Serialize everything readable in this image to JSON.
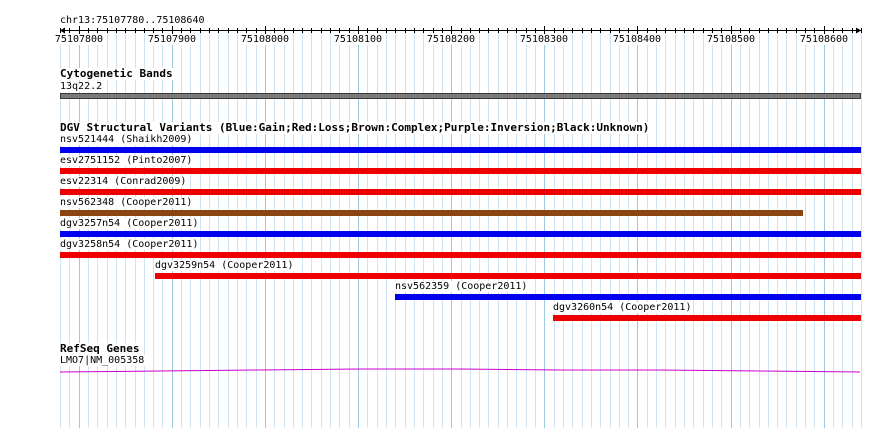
{
  "ruler": {
    "location": "chr13:75107780..75108640",
    "ticks": [
      "75107800",
      "75107900",
      "75108000",
      "75108100",
      "75108200",
      "75108300",
      "75108400",
      "75108500",
      "75108600"
    ]
  },
  "cytobands": {
    "title": "Cytogenetic Bands",
    "band_label": "13q22.2",
    "band_color": "#7a7a7a"
  },
  "dgv": {
    "title": "DGV Structural Variants (Blue:Gain;Red:Loss;Brown:Complex;Purple:Inversion;Black:Unknown)",
    "features": [
      {
        "label": "nsv521444 (Shaikh2009)",
        "start": 75107780,
        "end": 75108640,
        "color": "#0000ee"
      },
      {
        "label": "esv2751152 (Pinto2007)",
        "start": 75107780,
        "end": 75108640,
        "color": "#ee0000"
      },
      {
        "label": "esv22314 (Conrad2009)",
        "start": 75107780,
        "end": 75108640,
        "color": "#ee0000"
      },
      {
        "label": "nsv562348 (Cooper2011)",
        "start": 75107780,
        "end": 75108578,
        "color": "#8b4513"
      },
      {
        "label": "dgv3257n54 (Cooper2011)",
        "start": 75107780,
        "end": 75108640,
        "color": "#0000ee"
      },
      {
        "label": "dgv3258n54 (Cooper2011)",
        "start": 75107780,
        "end": 75108640,
        "color": "#ee0000"
      },
      {
        "label": "dgv3259n54 (Cooper2011)",
        "start": 75107882,
        "end": 75108640,
        "color": "#ee0000"
      },
      {
        "label": "nsv562359 (Cooper2011)",
        "start": 75108140,
        "end": 75108640,
        "color": "#0000ee"
      },
      {
        "label": "dgv3260n54 (Cooper2011)",
        "start": 75108309,
        "end": 75108640,
        "color": "#ee0000"
      }
    ]
  },
  "refseq": {
    "title": "RefSeq Genes",
    "gene_label": "LMO7|NM_005358",
    "gene_color": "#cc00cc"
  }
}
